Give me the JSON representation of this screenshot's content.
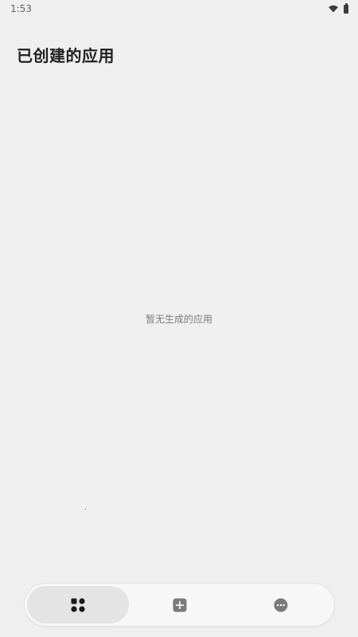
{
  "status_bar": {
    "time": "1:53",
    "icons": [
      "wifi-icon",
      "battery-icon"
    ]
  },
  "header": {
    "title": "已创建的应用"
  },
  "main": {
    "empty_message": "暂无生成的应用"
  },
  "bottom_nav": {
    "items": [
      {
        "icon": "apps-grid-icon",
        "active": true
      },
      {
        "icon": "add-square-icon",
        "active": false
      },
      {
        "icon": "more-circle-icon",
        "active": false
      }
    ]
  },
  "colors": {
    "background": "#efefef",
    "nav_background": "#f7f7f7",
    "nav_active": "#e4e4e4",
    "title_text": "#1f1f1f",
    "muted_text": "#7b7b7b",
    "icon_dark": "#1a1a1a",
    "icon_gray": "#7a7a7a"
  }
}
